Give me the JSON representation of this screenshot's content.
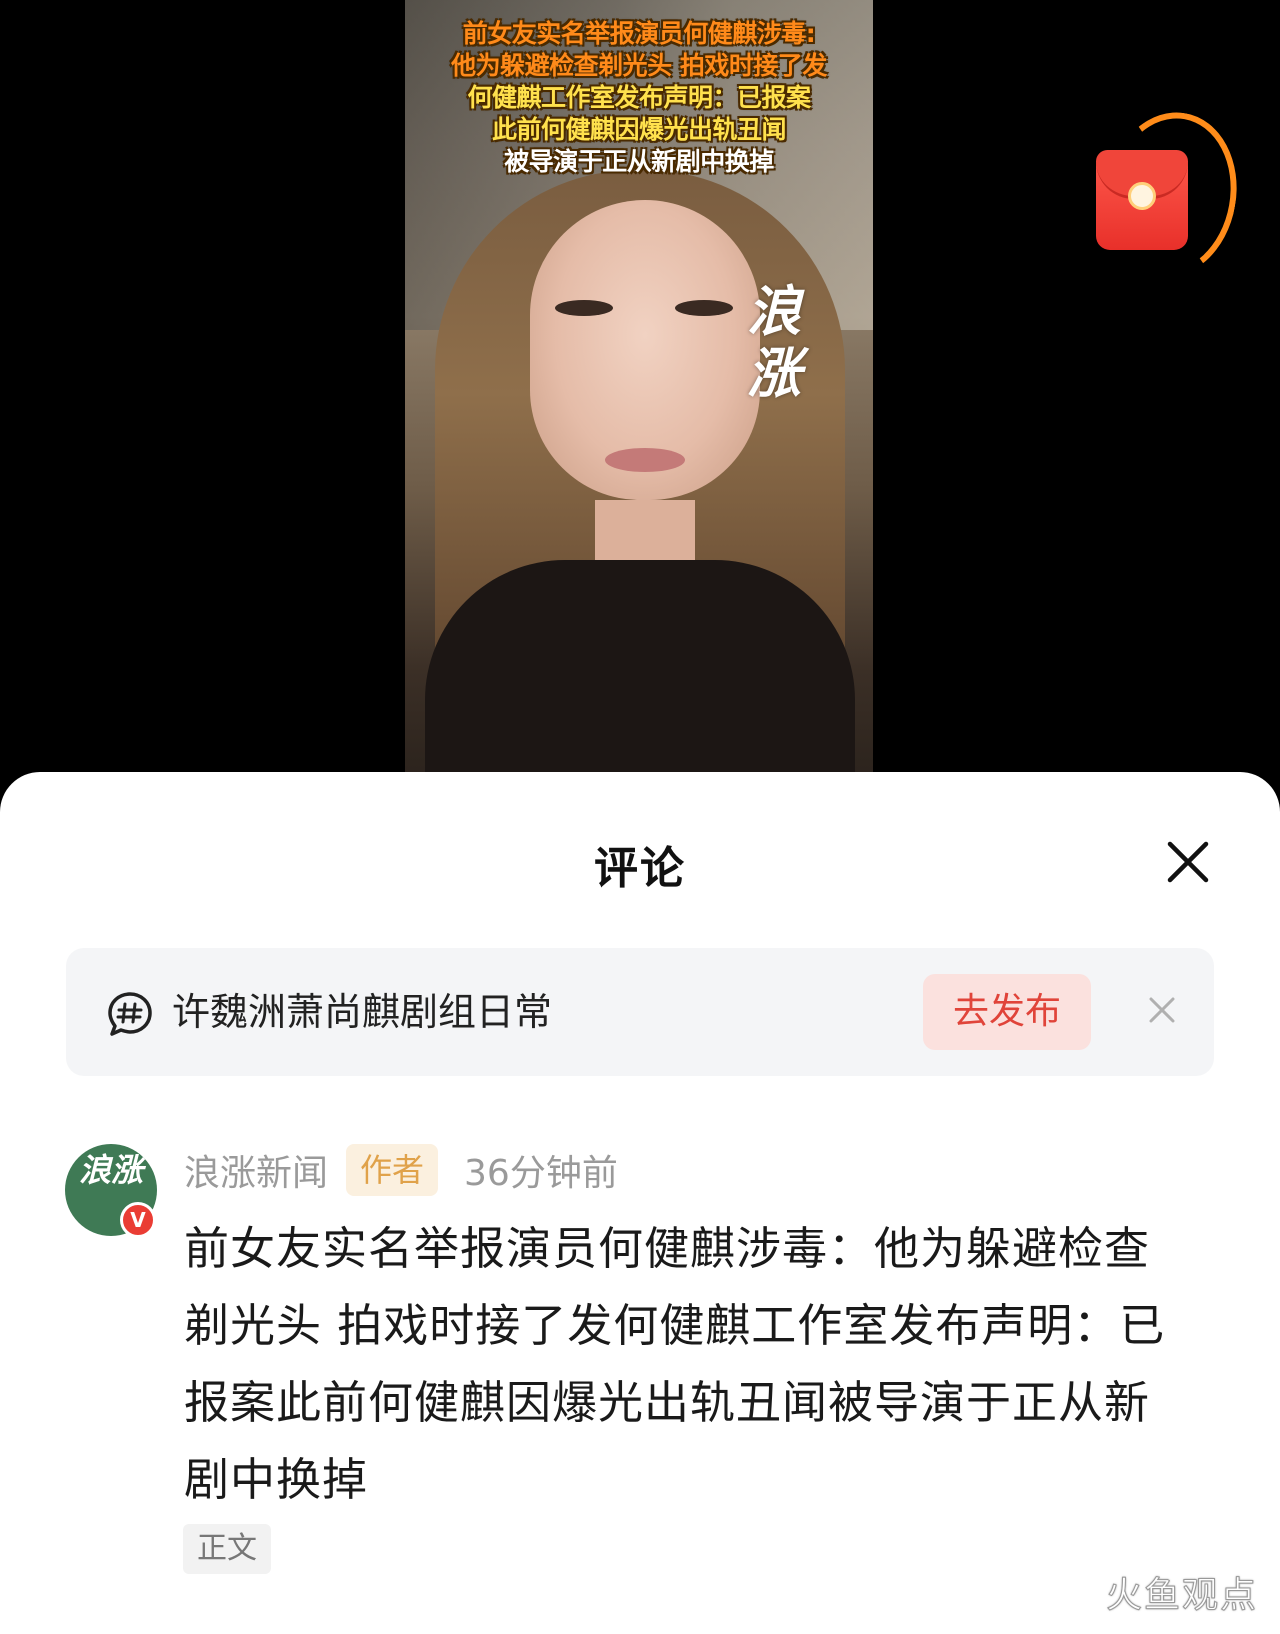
{
  "video": {
    "caption_lines": [
      "前女友实名举报演员何健麒涉毒:",
      "他为躲避检查剃光头 拍戏时接了发",
      "何健麒工作室发布声明：已报案",
      "此前何健麒因爆光出轨丑闻",
      "被导演于正从新剧中换掉"
    ],
    "logo_text": "浪涨",
    "red_packet_icon": "red-envelope-icon"
  },
  "comments_panel": {
    "title": "评论",
    "close_icon": "close-icon",
    "topic": {
      "icon": "topic-hashtag-icon",
      "text": "许魏洲萧尚麒剧组日常",
      "publish_label": "去发布",
      "dismiss_icon": "close-icon"
    },
    "comment": {
      "avatar_text": "浪涨",
      "verified_mark": "V",
      "author": "浪涨新闻",
      "badge": "作者",
      "time": "36分钟前",
      "text": "前女友实名举报演员何健麒涉毒：他为躲避检查剃光头 拍戏时接了发何健麒工作室发布声明：已报案此前何健麒因爆光出轨丑闻被导演于正从新剧中换掉",
      "tag": "正文"
    }
  },
  "page_watermark": "火鱼观点",
  "colors": {
    "accent_red": "#e0443a",
    "publish_bg": "#fbe1de",
    "author_badge_text": "#e0a24a",
    "caption_orange": "#ff8a1a",
    "caption_yellow": "#ffe14d",
    "avatar_green": "#3f7a55"
  }
}
